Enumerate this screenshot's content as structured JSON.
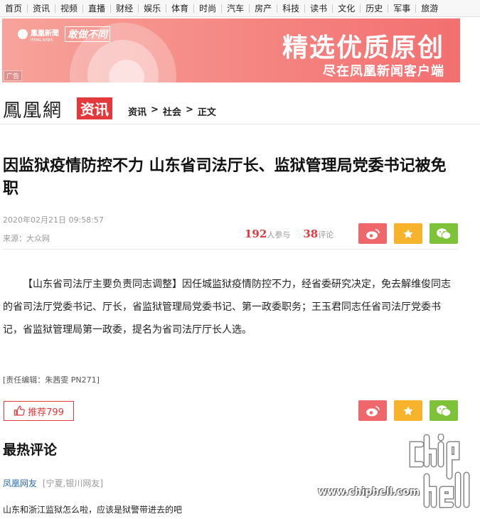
{
  "nav": [
    "首页",
    "资讯",
    "视频",
    "直播",
    "财经",
    "娱乐",
    "体育",
    "时尚",
    "汽车",
    "房产",
    "科技",
    "读书",
    "文化",
    "历史",
    "军事",
    "旅游"
  ],
  "banner": {
    "logo_text": "鳳凰新聞",
    "logo_sub": "IFENG.NEWS",
    "slogan": "敢做不同",
    "headline": "精选优质原创",
    "subline": "尽在凤凰新闻客户端",
    "ad_tag": "广告"
  },
  "header": {
    "brand": "鳳凰網",
    "brand_tag": "资讯",
    "breadcrumb": [
      "资讯",
      "社会",
      "正文"
    ],
    "sep": ">"
  },
  "article": {
    "title": "因监狱疫情防控不力 山东省司法厅长、监狱管理局党委书记被免职",
    "date": "2020年02月21日 09:58:57",
    "source": "来源：大众网",
    "participants": "192",
    "participants_label": "人参与",
    "comments": "38",
    "comments_label": "评论",
    "body": "【山东省司法厅主要负责同志调整】因任城监狱疫情防控不力，经省委研究决定，免去解维俊同志的省司法厅党委书记、厅长，省监狱管理局党委书记、第一政委职务；王玉君同志任省司法厅党委书记，省监狱管理局第一政委，提名为省司法厅厅长人选。",
    "editor": "[责任编辑：朱茜雯 PN271]",
    "recommend": "推荐799"
  },
  "comments_section": {
    "title": "最热评论",
    "user": "凤凰网友",
    "location": "[宁夏,银川网友]",
    "text": "山东和浙江监狱怎么啦，应该是狱警带进去的吧"
  },
  "watermark": {
    "site": "www.chiphell.com"
  },
  "share_icons": [
    "weibo-icon",
    "star-icon",
    "wechat-icon"
  ],
  "colors": {
    "accent": "#e4393c",
    "weibo": "#f0676b",
    "favorite": "#f6b32b",
    "wechat": "#7dc238",
    "link": "#2b6cb0"
  }
}
